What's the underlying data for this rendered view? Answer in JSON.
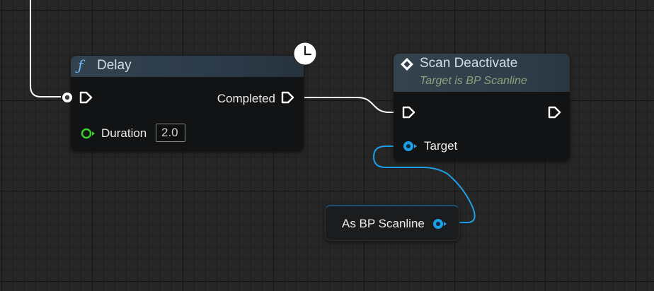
{
  "nodes": {
    "delay": {
      "icon": "function-icon",
      "title": "Delay",
      "badge_icon": "clock-icon",
      "output_label": "Completed",
      "duration_label": "Duration",
      "duration_value": "2.0"
    },
    "scan_deactivate": {
      "icon": "event-call-icon",
      "title": "Scan Deactivate",
      "subtitle": "Target is BP Scanline",
      "target_label": "Target"
    },
    "cast": {
      "label": "As BP Scanline"
    }
  },
  "colors": {
    "background": "#262626",
    "exec_pin": "#ffffff",
    "float_pin": "#3fd12e",
    "object_pin": "#1d9fe8",
    "header": "#2f3e4c",
    "subtitle": "#8ca27a"
  }
}
